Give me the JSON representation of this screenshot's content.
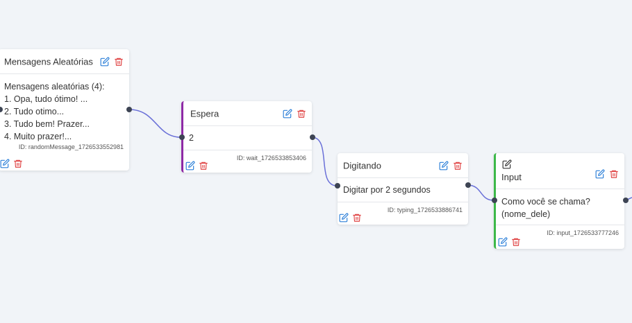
{
  "colors": {
    "background": "#f1f4f8",
    "edge": "#6a70d8",
    "edit_icon": "#2b7fd8",
    "delete_icon": "#e04545",
    "wait_accent": "#8e2aa6",
    "input_accent": "#3cb848"
  },
  "nodes": {
    "random": {
      "title": "Mensagens Aleatórias",
      "summary": "Mensagens aleatórias (4):",
      "items": [
        "1. Opa, tudo ótimo! ...",
        "2. Tudo otimo...",
        "3. Tudo bem! Prazer...",
        "4. Muito prazer!..."
      ],
      "id_text": "ID: randomMessage_1726533552981"
    },
    "wait": {
      "title": "Espera",
      "value": "2",
      "id_text": "ID: wait_1726533853406"
    },
    "typing": {
      "title": "Digitando",
      "value": "Digitar por 2 segundos",
      "id_text": "ID: typing_1726533886741"
    },
    "input": {
      "header_icon": "edit-square-icon",
      "title": "Input",
      "line1": "Como você se chama?",
      "line2": "(nome_dele)",
      "id_text": "ID: input_1726533777246"
    }
  },
  "icons": {
    "edit": "pencil-square-icon",
    "delete": "trash-icon"
  }
}
